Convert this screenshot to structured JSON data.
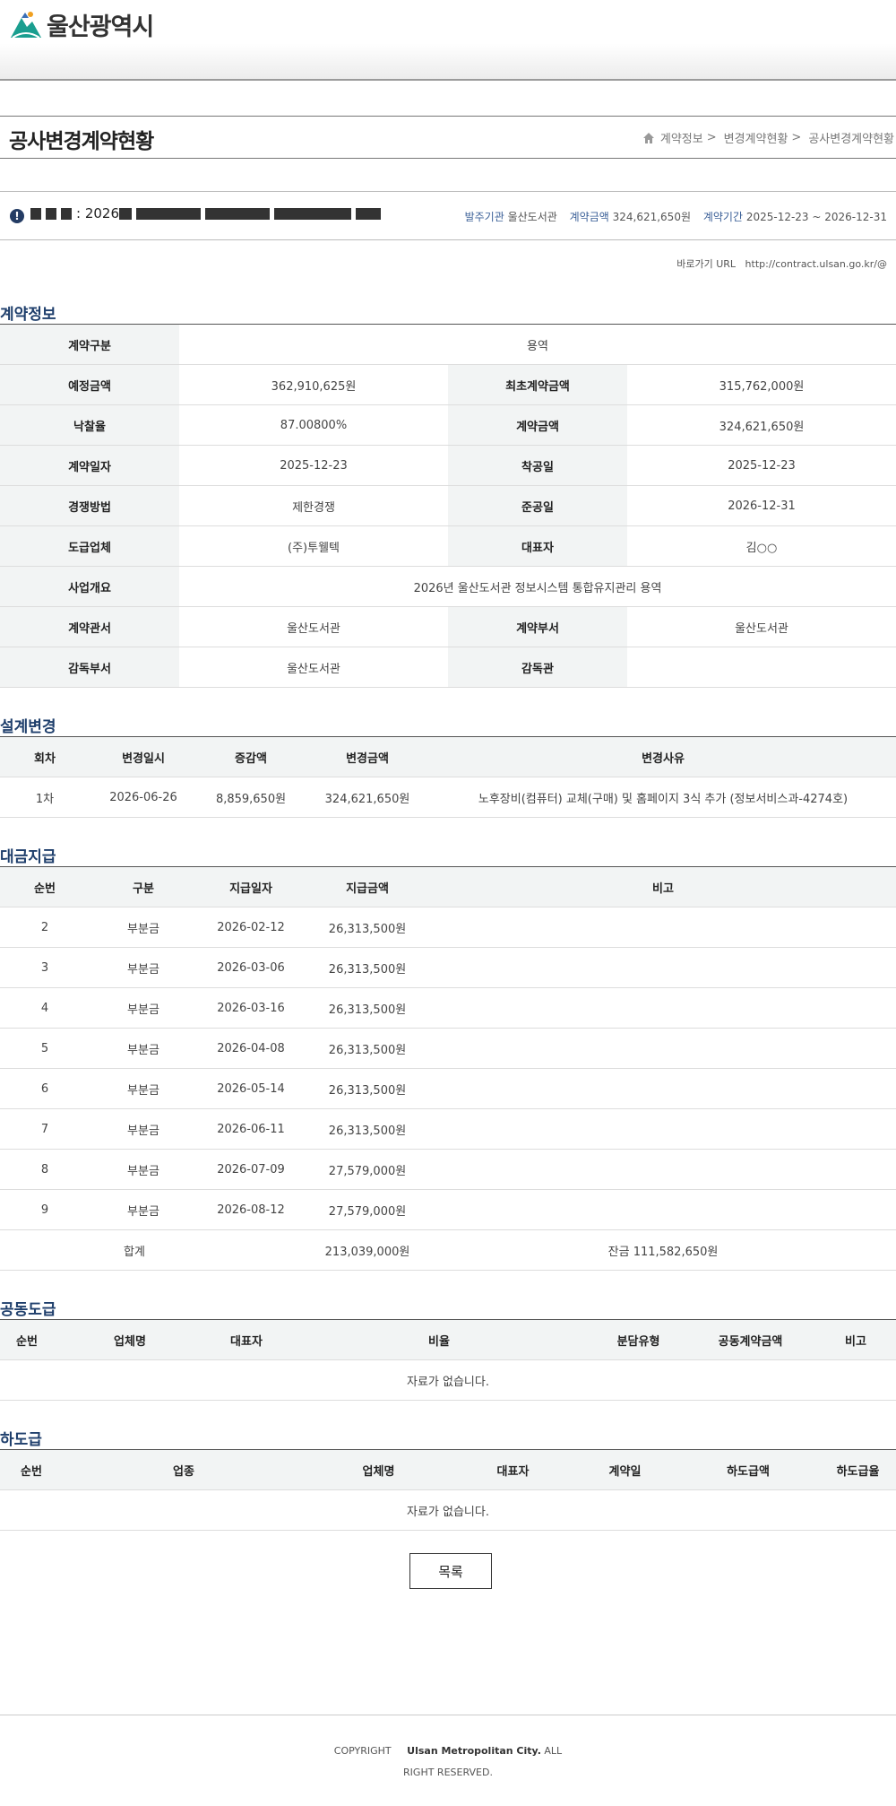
{
  "header": {
    "logo_text": "울산광역시"
  },
  "title": "공사변경계약현황",
  "breadcrumb": [
    "계약정보",
    "변경계약현황",
    "공사변경계약현황"
  ],
  "summary": {
    "name_prefix": ": 2026",
    "org_label": "발주기관",
    "org_value": "울산도서관",
    "amount_label": "계약금액",
    "amount_value": "324,621,650원",
    "period_label": "계약기간",
    "period_value": "2025-12-23 ~ 2026-12-31"
  },
  "url": {
    "label": "바로가기 URL",
    "value": "http://contract.ulsan.go.kr/@"
  },
  "contract_info": {
    "title": "계약정보",
    "type_label": "계약구분",
    "type_value": "용역",
    "est_label": "예정금액",
    "est_value": "362,910,625원",
    "init_label": "최초계약금액",
    "init_value": "315,762,000원",
    "rate_label": "낙찰율",
    "rate_value": "87.00800%",
    "amt_label": "계약금액",
    "amt_value": "324,621,650원",
    "date_label": "계약일자",
    "date_value": "2025-12-23",
    "start_label": "착공일",
    "start_value": "2025-12-23",
    "method_label": "경쟁방법",
    "method_value": "제한경쟁",
    "end_label": "준공일",
    "end_value": "2026-12-31",
    "vendor_label": "도급업체",
    "vendor_value": "(주)투웰텍",
    "ceo_label": "대표자",
    "ceo_value": "김○○",
    "summary_label": "사업개요",
    "summary_value": "2026년 울산도서관 정보시스템 통합유지관리 용역",
    "office_label": "계약관서",
    "office_value": "울산도서관",
    "dept_label": "계약부서",
    "dept_value": "울산도서관",
    "sup_label": "감독부서",
    "sup_value": "울산도서관",
    "supvr_label": "감독관",
    "supvr_value": ""
  },
  "design_change": {
    "title": "설계변경",
    "headers": [
      "회차",
      "변경일시",
      "증감액",
      "변경금액",
      "변경사유"
    ],
    "rows": [
      [
        "1차",
        "2026-06-26",
        "8,859,650원",
        "324,621,650원",
        "노후장비(컴퓨터) 교체(구매) 및 홈페이지 3식 추가 (정보서비스과-4274호)"
      ]
    ]
  },
  "payment": {
    "title": "대금지급",
    "headers": [
      "순번",
      "구분",
      "지급일자",
      "지급금액",
      "비고"
    ],
    "rows": [
      [
        "2",
        "부분금",
        "2026-02-12",
        "26,313,500원",
        ""
      ],
      [
        "3",
        "부분금",
        "2026-03-06",
        "26,313,500원",
        ""
      ],
      [
        "4",
        "부분금",
        "2026-03-16",
        "26,313,500원",
        ""
      ],
      [
        "5",
        "부분금",
        "2026-04-08",
        "26,313,500원",
        ""
      ],
      [
        "6",
        "부분금",
        "2026-05-14",
        "26,313,500원",
        ""
      ],
      [
        "7",
        "부분금",
        "2026-06-11",
        "26,313,500원",
        ""
      ],
      [
        "8",
        "부분금",
        "2026-07-09",
        "27,579,000원",
        ""
      ],
      [
        "9",
        "부분금",
        "2026-08-12",
        "27,579,000원",
        ""
      ]
    ],
    "total_label": "합계",
    "total_value": "213,039,000원",
    "balance": "잔금 111,582,650원"
  },
  "joint": {
    "title": "공동도급",
    "headers": [
      "순번",
      "업체명",
      "대표자",
      "비율",
      "분담유형",
      "공동계약금액",
      "비고"
    ],
    "empty": "자료가 없습니다."
  },
  "subcontract": {
    "title": "하도급",
    "headers": [
      "순번",
      "업종",
      "업체명",
      "대표자",
      "계약일",
      "하도급액",
      "하도급율"
    ],
    "empty": "자료가 없습니다."
  },
  "list_button": "목록",
  "footer": {
    "copyright_a": "COPYRIGHT",
    "copyright_b": "Ulsan Metropolitan City.",
    "copyright_c": "ALL RIGHT RESERVED."
  }
}
